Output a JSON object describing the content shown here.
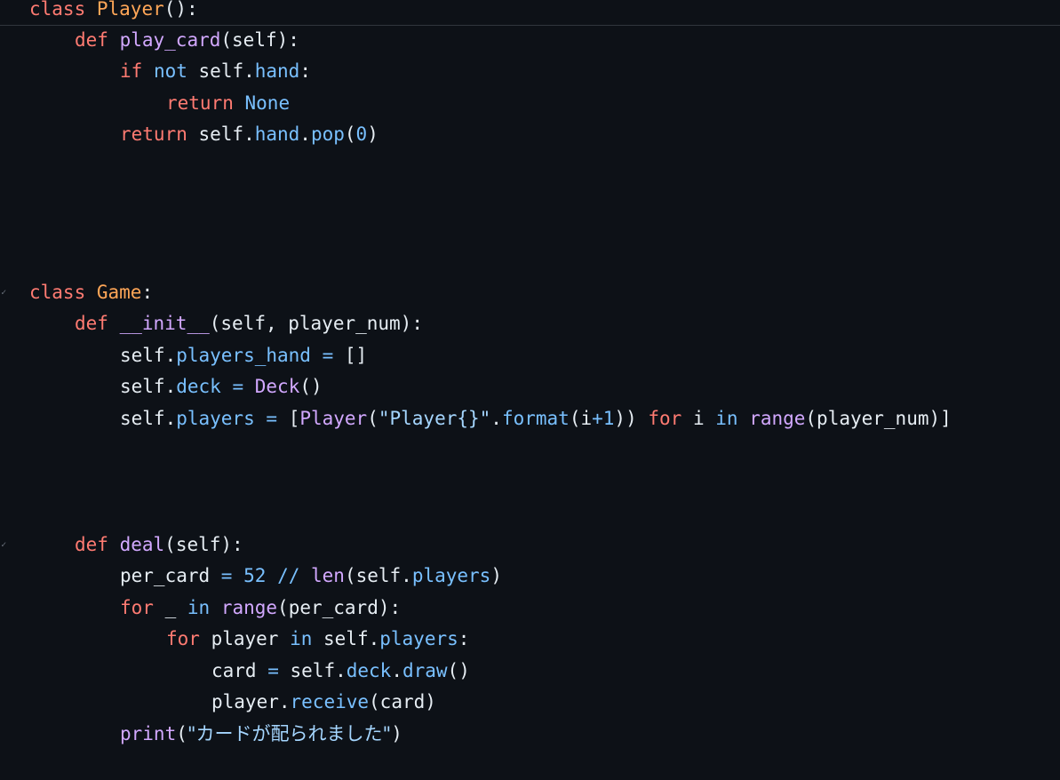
{
  "editor": {
    "theme": {
      "background": "#0d1117",
      "keyword": "#ff7b72",
      "function_name": "#d2a8ff",
      "class_name": "#ffa657",
      "property": "#79c0ff",
      "string": "#a5d6ff",
      "plain": "#e6edf3"
    },
    "lines": {
      "l1": [
        "class",
        " ",
        "Player",
        "():"
      ],
      "l2": [
        "def",
        " ",
        "play_card",
        "(self):"
      ],
      "l3": [
        "if",
        " ",
        "not",
        " self.",
        "hand",
        ":"
      ],
      "l4": [
        "return",
        " ",
        "None"
      ],
      "l5": [
        "return",
        " self.",
        "hand",
        ".",
        "pop",
        "(",
        "0",
        ")"
      ],
      "l6": [
        "class",
        " ",
        "Game",
        ":"
      ],
      "l7": [
        "def",
        " ",
        "__init__",
        "(self, player_num):"
      ],
      "l8": [
        "self.",
        "players_hand",
        " ",
        "=",
        " []"
      ],
      "l9": [
        "self.",
        "deck",
        " ",
        "=",
        " ",
        "Deck",
        "()"
      ],
      "l10": [
        "self.",
        "players",
        " ",
        "=",
        " [",
        "Player",
        "(",
        "\"Player{}\"",
        ".",
        "format",
        "(i",
        "+",
        "1",
        ")) ",
        "for",
        " i ",
        "in",
        " ",
        "range",
        "(player_num)]"
      ],
      "l11": [
        "def",
        " ",
        "deal",
        "(self):"
      ],
      "l12": [
        "per_card ",
        "=",
        " ",
        "52",
        " ",
        "//",
        " ",
        "len",
        "(self.",
        "players",
        ")"
      ],
      "l13": [
        "for",
        " _ ",
        "in",
        " ",
        "range",
        "(per_card):"
      ],
      "l14": [
        "for",
        " player ",
        "in",
        " self.",
        "players",
        ":"
      ],
      "l15": [
        "card ",
        "=",
        " self.",
        "deck",
        ".",
        "draw",
        "()"
      ],
      "l16": [
        "player.",
        "receive",
        "(card)"
      ],
      "l17": [
        "print",
        "(",
        "\"カードが配られました\"",
        ")"
      ]
    }
  }
}
